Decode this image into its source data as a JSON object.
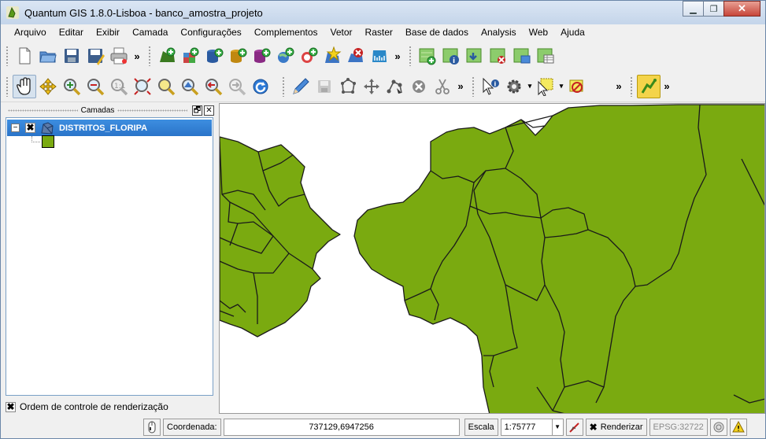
{
  "window": {
    "title": "Quantum GIS 1.8.0-Lisboa - banco_amostra_projeto",
    "minimize": "▁",
    "maximize": "❐",
    "close": "✕"
  },
  "menu": {
    "items": [
      "Arquivo",
      "Editar",
      "Exibir",
      "Camada",
      "Configurações",
      "Complementos",
      "Vetor",
      "Raster",
      "Base de dados",
      "Analysis",
      "Web",
      "Ajuda"
    ]
  },
  "toolbar": {
    "more": "»"
  },
  "layers_panel": {
    "title": "Camadas",
    "float_button": "🗗",
    "close_button": "✕",
    "layer": {
      "name": "DISTRITOS_FLORIPA",
      "checked": true,
      "check_mark": "✖",
      "expand_symbol": "−",
      "symbol_color": "#7aaa10"
    },
    "render_order_label": "Ordem de controle de renderização",
    "render_order_checked": true
  },
  "map": {
    "fill_color": "#7aaa10",
    "stroke_color": "#1a1a1a",
    "background": "#ffffff"
  },
  "statusbar": {
    "coordinate_label": "Coordenada:",
    "coordinate_value": "737129,6947256",
    "scale_label": "Escala",
    "scale_value": "1:75777",
    "render_label": "Renderizar",
    "render_checked": true,
    "epsg": "EPSG:32722"
  }
}
